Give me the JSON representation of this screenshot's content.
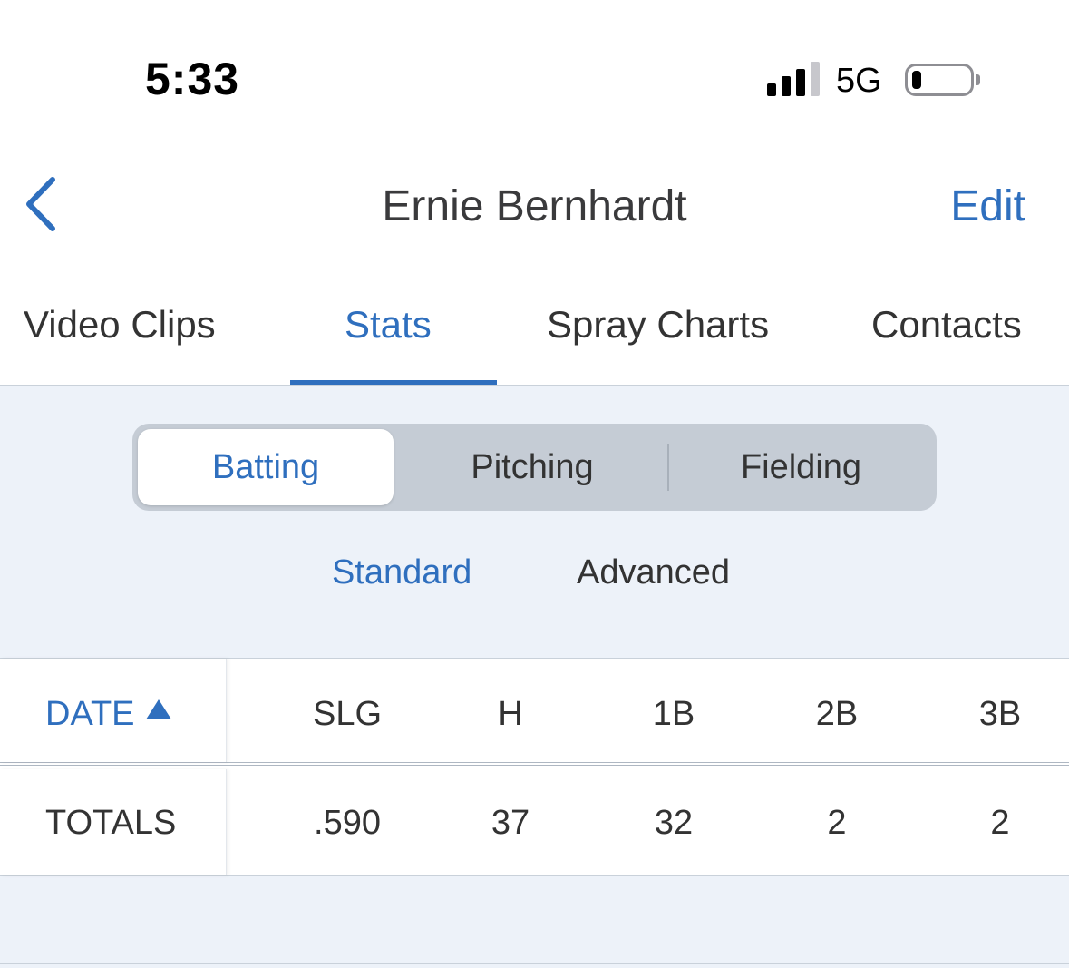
{
  "status": {
    "time": "5:33",
    "network": "5G",
    "signal_bars": 3,
    "battery_level": 0.12
  },
  "nav": {
    "back_icon": "chevron-left-icon",
    "title": "Ernie Bernhardt",
    "edit_label": "Edit"
  },
  "tabs": [
    {
      "label": "Video Clips",
      "active": false
    },
    {
      "label": "Stats",
      "active": true
    },
    {
      "label": "Spray Charts",
      "active": false
    },
    {
      "label": "Contacts",
      "active": false
    }
  ],
  "segments": [
    {
      "label": "Batting",
      "active": true
    },
    {
      "label": "Pitching",
      "active": false
    },
    {
      "label": "Fielding",
      "active": false
    }
  ],
  "subtabs": [
    {
      "label": "Standard",
      "active": true
    },
    {
      "label": "Advanced",
      "active": false
    }
  ],
  "table": {
    "sort_column": "DATE",
    "sort_icon": "triangle-up-icon",
    "columns": [
      "SLG",
      "H",
      "1B",
      "2B",
      "3B"
    ],
    "rows": [
      {
        "label": "TOTALS",
        "values": [
          ".590",
          "37",
          "32",
          "2",
          "2"
        ]
      }
    ]
  },
  "colors": {
    "accent": "#2f6fbe",
    "background": "#edf2f9",
    "text": "#333333"
  }
}
